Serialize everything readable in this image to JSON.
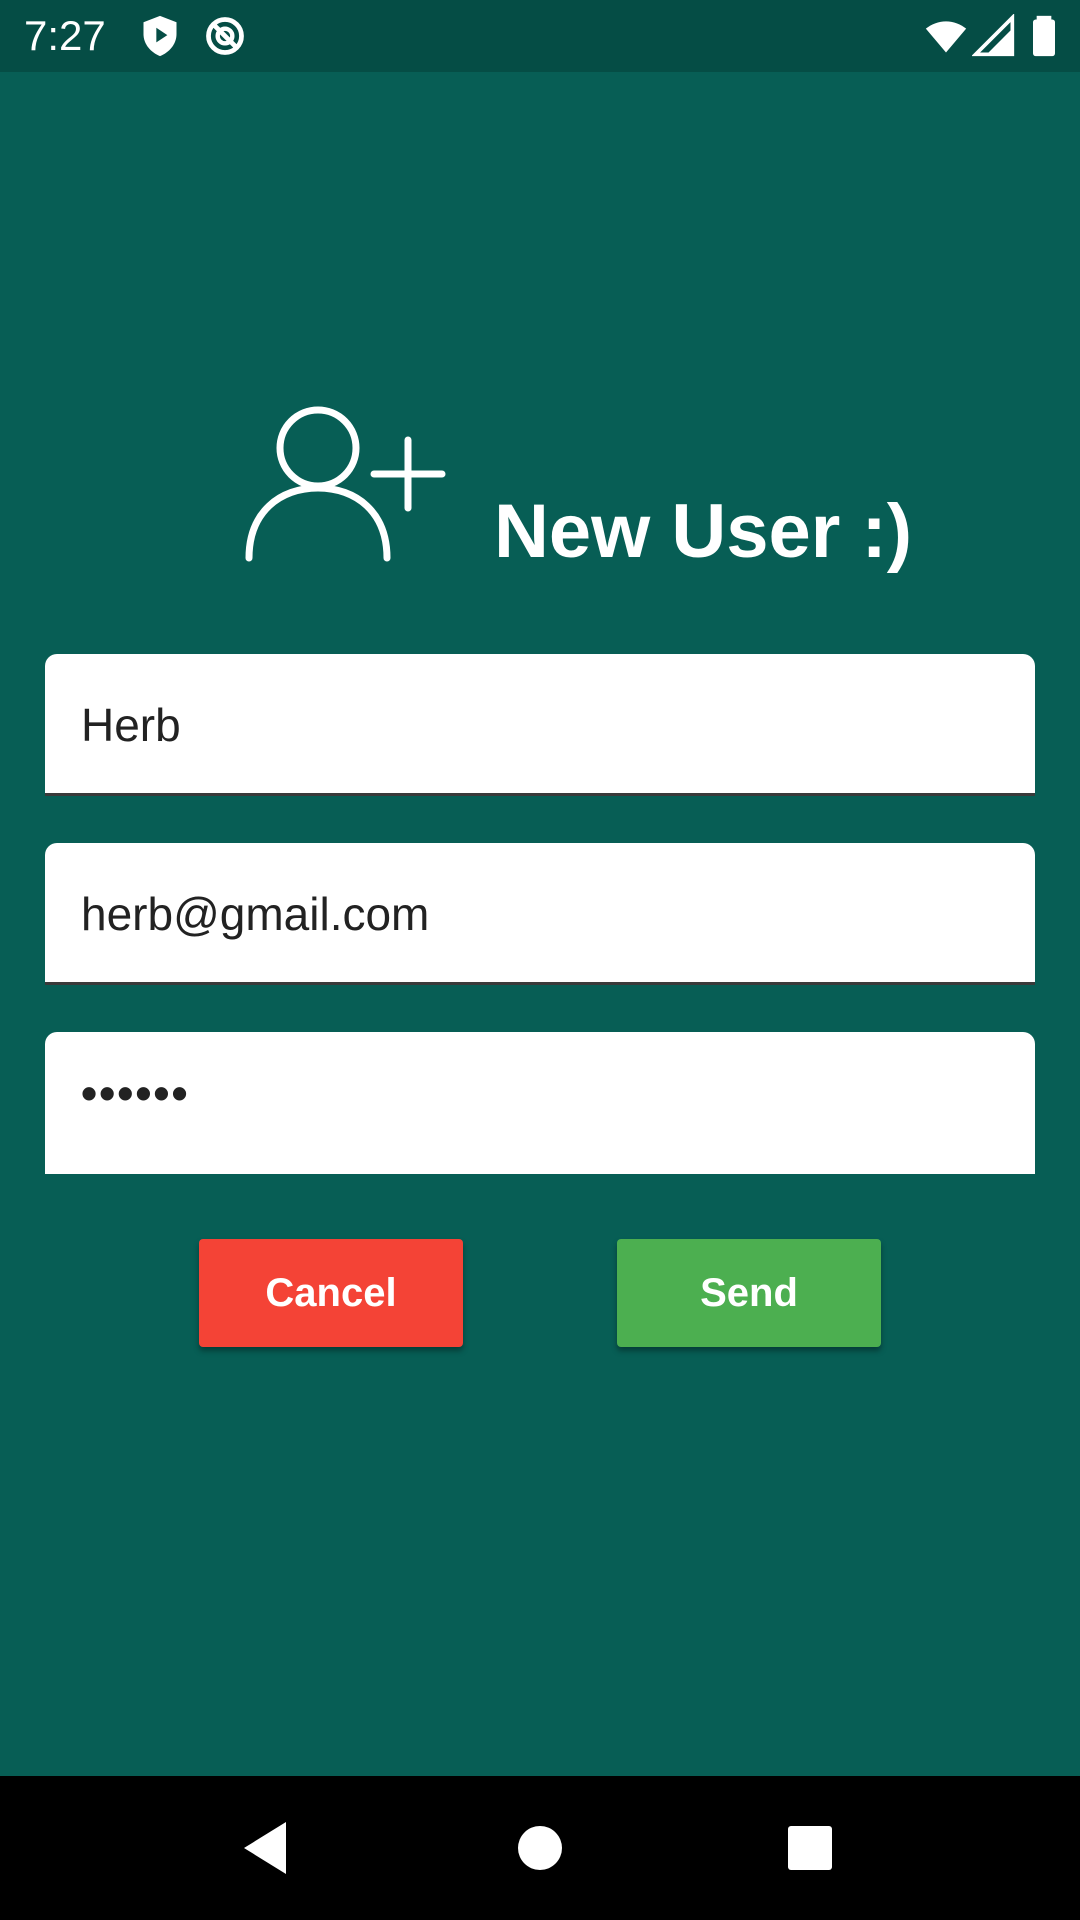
{
  "status_bar": {
    "time": "7:27",
    "icons": [
      "shield-play-icon",
      "no-sync-icon",
      "wifi-icon",
      "cell-signal-icon",
      "battery-icon"
    ]
  },
  "header": {
    "icon": "add-user-icon",
    "title": "New User :)"
  },
  "form": {
    "name_value": "Herb",
    "email_value": "herb@gmail.com",
    "password_value": "••••••"
  },
  "buttons": {
    "cancel_label": "Cancel",
    "send_label": "Send"
  },
  "nav_bar": {
    "icons": [
      "back-icon",
      "home-icon",
      "recents-icon"
    ]
  },
  "colors": {
    "background": "#075e55",
    "status_bar": "#054d45",
    "cancel": "#f44336",
    "send": "#4caf50"
  }
}
